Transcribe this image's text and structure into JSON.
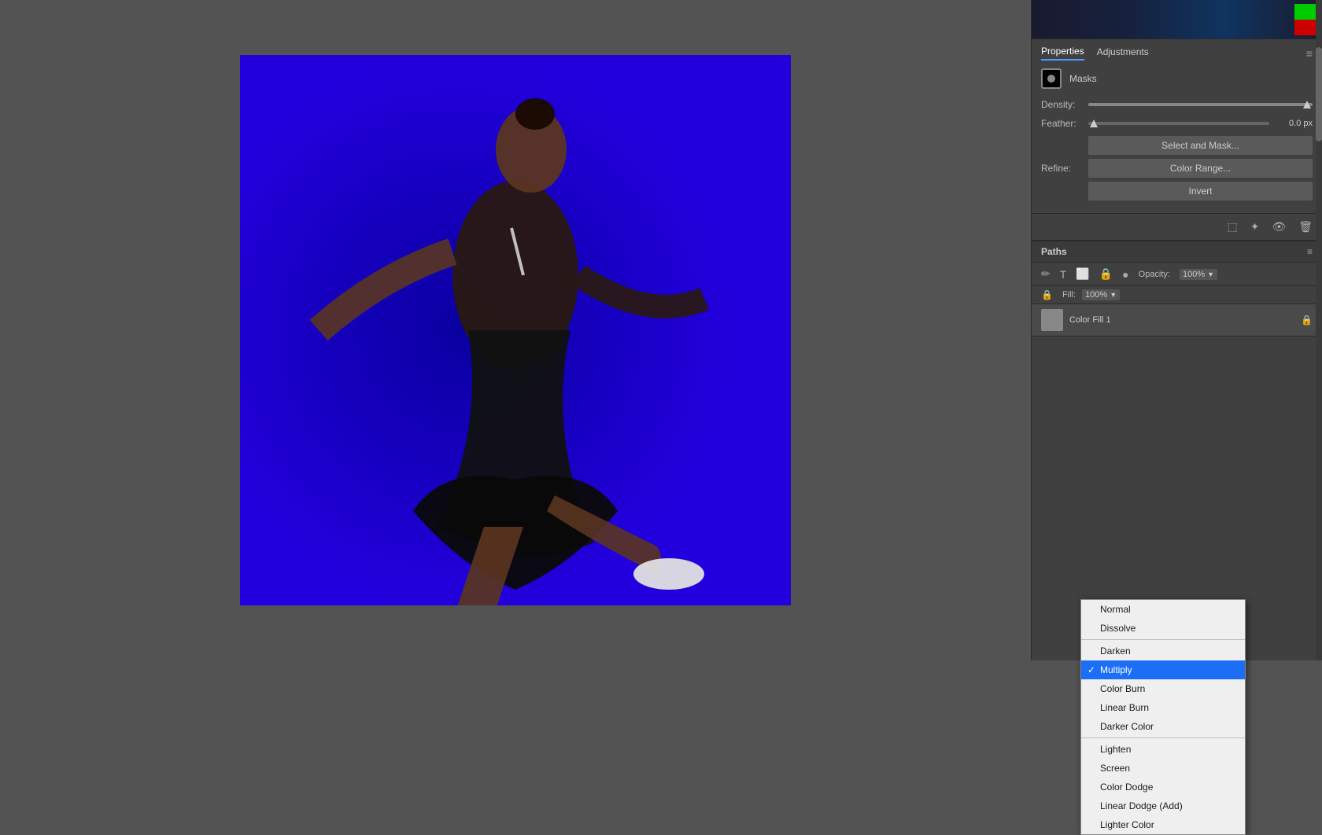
{
  "canvas": {
    "alt": "Fashion photo - woman in black dress on blue background"
  },
  "gradientBar": {
    "colorSwatches": [
      "#00cc00",
      "#cc0000"
    ]
  },
  "propertiesPanel": {
    "title": "Properties",
    "tabs": [
      "Properties",
      "Adjustments"
    ],
    "activeTab": "Properties",
    "menuIcon": "≡",
    "masksLabel": "Masks",
    "densityLabel": "Density:",
    "featherLabel": "Feather:",
    "featherValue": "0.0 px",
    "refineLabel": "Refine:",
    "selectAndMaskButton": "Select and Mask...",
    "colorRangeButton": "Color Range...",
    "invertButton": "Invert"
  },
  "iconsRow": {
    "icons": [
      "⊞",
      "✦",
      "👁",
      "🗑"
    ]
  },
  "pathsPanel": {
    "title": "Paths",
    "menuIcon": "≡",
    "toolIcons": [
      "✏",
      "T",
      "⬜",
      "🔒",
      "●"
    ],
    "opacityLabel": "Opacity:",
    "opacityValue": "100%",
    "fillLabel": "Fill:",
    "fillValue": "100%",
    "layerName": "Color Fill 1",
    "lockIcon": "🔒"
  },
  "blendDropdown": {
    "items": [
      {
        "label": "Normal",
        "selected": false,
        "separator_after": false
      },
      {
        "label": "Dissolve",
        "selected": false,
        "separator_after": true
      },
      {
        "label": "Darken",
        "selected": false,
        "separator_after": false
      },
      {
        "label": "Multiply",
        "selected": true,
        "separator_after": false
      },
      {
        "label": "Color Burn",
        "selected": false,
        "separator_after": false
      },
      {
        "label": "Linear Burn",
        "selected": false,
        "separator_after": false
      },
      {
        "label": "Darker Color",
        "selected": false,
        "separator_after": true
      },
      {
        "label": "Lighten",
        "selected": false,
        "separator_after": false
      },
      {
        "label": "Screen",
        "selected": false,
        "separator_after": false
      },
      {
        "label": "Color Dodge",
        "selected": false,
        "separator_after": false
      },
      {
        "label": "Linear Dodge (Add)",
        "selected": false,
        "separator_after": false
      },
      {
        "label": "Lighter Color",
        "selected": false,
        "separator_after": false
      }
    ]
  }
}
